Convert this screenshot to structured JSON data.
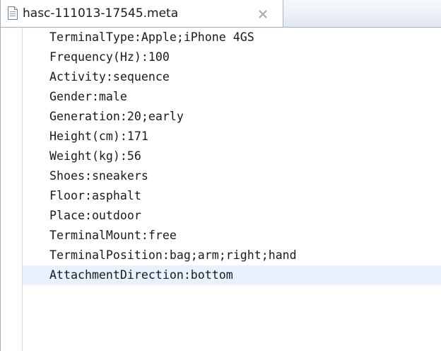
{
  "tab": {
    "title": "hasc-111013-17545.meta",
    "icon": "text-file-icon",
    "close_icon": "close-icon"
  },
  "editor": {
    "lines": [
      "TerminalType:Apple;iPhone 4GS",
      "Frequency(Hz):100",
      "Activity:sequence",
      "Gender:male",
      "Generation:20;early",
      "Height(cm):171",
      "Weight(kg):56",
      "Shoes:sneakers",
      "Floor:asphalt",
      "Place:outdoor",
      "TerminalMount:free",
      "TerminalPosition:bag;arm;right;hand",
      "AttachmentDirection:bottom"
    ],
    "current_line_index": 12
  },
  "colors": {
    "current_line": "#e8f2fe",
    "tab_border": "#a7b3c8"
  }
}
